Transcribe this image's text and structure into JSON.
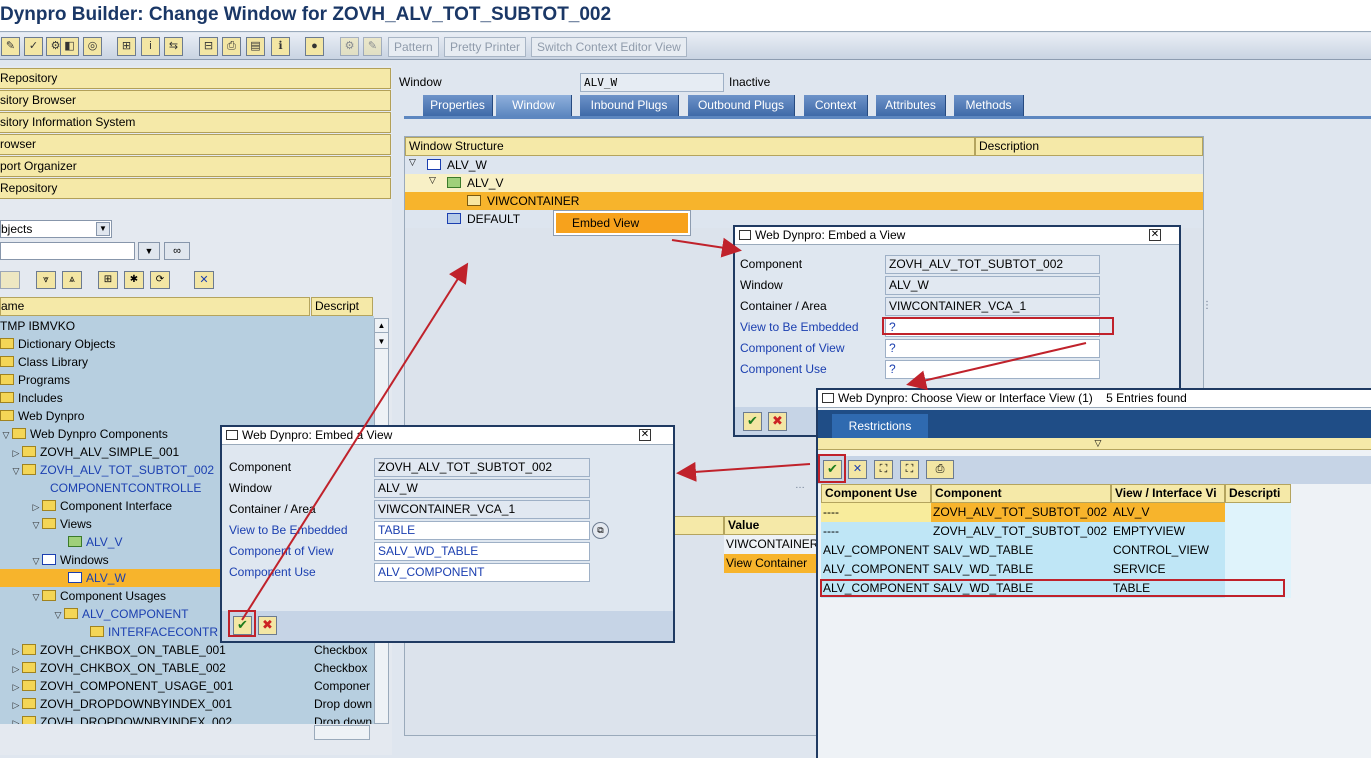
{
  "title": "Dynpro Builder: Change Window for ZOVH_ALV_TOT_SUBTOT_002",
  "toolbar": {
    "buttons": [
      "Pattern",
      "Pretty Printer",
      "Switch Context Editor View"
    ]
  },
  "nav": {
    "items": [
      "Repository",
      "sitory Browser",
      "sitory Information System",
      "rowser",
      "port Organizer",
      "Repository"
    ],
    "object_select": "bjects",
    "tree_header_name": "ame",
    "tree_header_desc": "Descript",
    "tree": [
      {
        "label": "TMP IBMVKO",
        "desc": ""
      },
      {
        "label": "Dictionary Objects",
        "desc": ""
      },
      {
        "label": "Class Library",
        "desc": ""
      },
      {
        "label": "Programs",
        "desc": ""
      },
      {
        "label": "Includes",
        "desc": ""
      },
      {
        "label": "Web Dynpro",
        "desc": ""
      },
      {
        "label": "Web Dynpro Components",
        "desc": ""
      },
      {
        "label": "ZOVH_ALV_SIMPLE_001",
        "desc": ""
      },
      {
        "label": "ZOVH_ALV_TOT_SUBTOT_002",
        "desc": ""
      },
      {
        "label": "COMPONENTCONTROLLE",
        "desc": ""
      },
      {
        "label": "Component Interface",
        "desc": ""
      },
      {
        "label": "Views",
        "desc": ""
      },
      {
        "label": "ALV_V",
        "desc": ""
      },
      {
        "label": "Windows",
        "desc": ""
      },
      {
        "label": "ALV_W",
        "desc": ""
      },
      {
        "label": "Component Usages",
        "desc": ""
      },
      {
        "label": "ALV_COMPONENT",
        "desc": ""
      },
      {
        "label": "INTERFACECONTR",
        "desc": ""
      },
      {
        "label": "ZOVH_CHKBOX_ON_TABLE_001",
        "desc": "Checkbox"
      },
      {
        "label": "ZOVH_CHKBOX_ON_TABLE_002",
        "desc": "Checkbox"
      },
      {
        "label": "ZOVH_COMPONENT_USAGE_001",
        "desc": "Componer"
      },
      {
        "label": "ZOVH_DROPDOWNBYINDEX_001",
        "desc": "Drop down"
      },
      {
        "label": "ZOVH_DROPDOWNBYINDEX_002",
        "desc": "Drop down"
      }
    ]
  },
  "header": {
    "window_label": "Window",
    "window_value": "ALV_W",
    "status": "Inactive"
  },
  "tabs": [
    "Properties",
    "Window",
    "Inbound Plugs",
    "Outbound Plugs",
    "Context",
    "Attributes",
    "Methods"
  ],
  "structure": {
    "col_structure": "Window Structure",
    "col_desc": "Description",
    "rows": [
      "ALV_W",
      "ALV_V",
      "VIWCONTAINER",
      "DEFAULT"
    ],
    "context_menu": "Embed View",
    "prop_col_value": "Value",
    "prop_values": [
      "VIWCONTAINER",
      "View Container"
    ]
  },
  "embed_dialog_top": {
    "title": "Web Dynpro: Embed a View",
    "labels": [
      "Component",
      "Window",
      "Container / Area",
      "View to Be Embedded",
      "Component of View",
      "Component Use"
    ],
    "values": [
      "ZOVH_ALV_TOT_SUBTOT_002",
      "ALV_W",
      "VIWCONTAINER_VCA_1",
      "?",
      "?",
      "?"
    ]
  },
  "embed_dialog_bottom": {
    "title": "Web Dynpro: Embed a View",
    "labels": [
      "Component",
      "Window",
      "Container / Area",
      "View to Be Embedded",
      "Component of View",
      "Component Use"
    ],
    "values": [
      "ZOVH_ALV_TOT_SUBTOT_002",
      "ALV_W",
      "VIWCONTAINER_VCA_1",
      "TABLE",
      "SALV_WD_TABLE",
      "ALV_COMPONENT"
    ]
  },
  "choose_dialog": {
    "title": "Web Dynpro: Choose View or Interface View (1)    5 Entries found",
    "tab": "Restrictions",
    "columns": [
      "Component Use",
      "Component",
      "View / Interface Vi",
      "Descripti"
    ],
    "rows": [
      [
        "----",
        "ZOVH_ALV_TOT_SUBTOT_002",
        "ALV_V",
        ""
      ],
      [
        "----",
        "ZOVH_ALV_TOT_SUBTOT_002",
        "EMPTYVIEW",
        ""
      ],
      [
        "ALV_COMPONENT",
        "SALV_WD_TABLE",
        "CONTROL_VIEW",
        ""
      ],
      [
        "ALV_COMPONENT",
        "SALV_WD_TABLE",
        "SERVICE",
        ""
      ],
      [
        "ALV_COMPONENT",
        "SALV_WD_TABLE",
        "TABLE",
        ""
      ]
    ]
  },
  "colors": {
    "accent_yellow": "#f5e9a8",
    "selection_orange": "#f7b42c",
    "annotation_red": "#c0222b",
    "tab_blue": "#3f6aa8"
  }
}
